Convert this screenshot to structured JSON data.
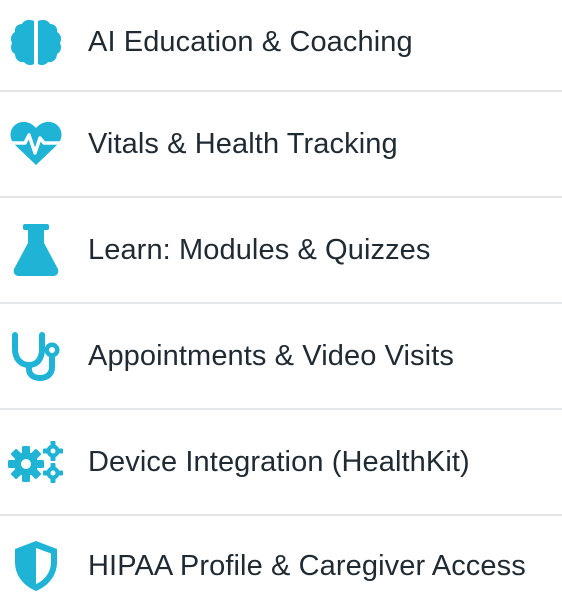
{
  "colors": {
    "accent": "#1fb4d6",
    "text": "#1f2a33",
    "divider": "#e4e6e8"
  },
  "features": [
    {
      "label": "AI Education & Coaching",
      "icon": "brain-icon"
    },
    {
      "label": "Vitals & Health Tracking",
      "icon": "heartbeat-icon"
    },
    {
      "label": "Learn: Modules & Quizzes",
      "icon": "flask-icon"
    },
    {
      "label": "Appointments & Video Visits",
      "icon": "stethoscope-icon"
    },
    {
      "label": "Device Integration (HealthKit)",
      "icon": "gears-icon"
    },
    {
      "label": "HIPAA Profile & Caregiver Access",
      "icon": "shield-icon"
    }
  ]
}
